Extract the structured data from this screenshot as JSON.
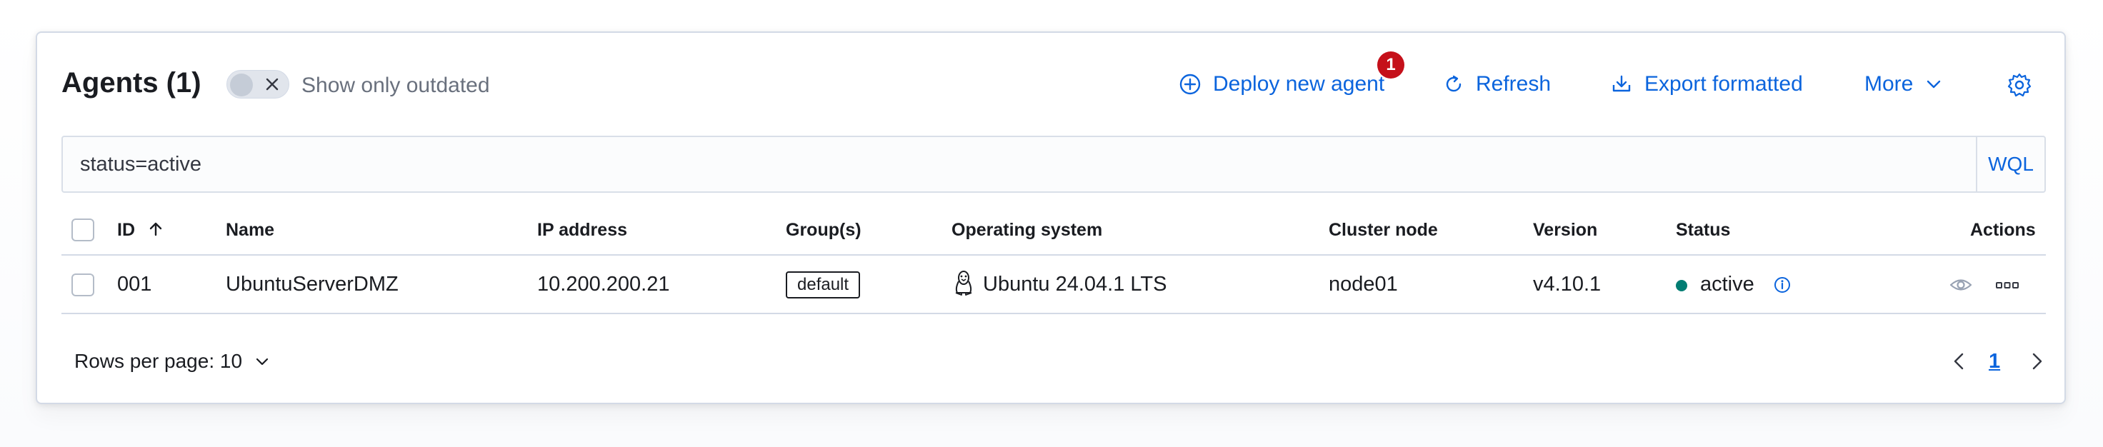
{
  "header": {
    "title": "Agents (1)",
    "toggle_label": "Show only outdated",
    "deploy_label": "Deploy new agent",
    "deploy_badge": "1",
    "refresh_label": "Refresh",
    "export_label": "Export formatted",
    "more_label": "More"
  },
  "search": {
    "value": "status=active",
    "language_button": "WQL"
  },
  "table": {
    "columns": [
      "ID",
      "Name",
      "IP address",
      "Group(s)",
      "Operating system",
      "Cluster node",
      "Version",
      "Status",
      "Actions"
    ],
    "rows": [
      {
        "id": "001",
        "name": "UbuntuServerDMZ",
        "ip": "10.200.200.21",
        "group": "default",
        "os": "Ubuntu 24.04.1 LTS",
        "cluster_node": "node01",
        "version": "v4.10.1",
        "status": "active"
      }
    ]
  },
  "footer": {
    "rows_per_page": "Rows per page: 10",
    "current_page": "1"
  },
  "colors": {
    "accent": "#0b64dd",
    "badge": "#c5101a",
    "status_active": "#017d73",
    "border": "#d3dae6"
  },
  "icons": {
    "deploy": "plus-circle-icon",
    "refresh": "refresh-icon",
    "export": "download-icon",
    "more": "chevron-down-icon",
    "settings": "gear-icon",
    "sort": "arrow-up-icon",
    "os": "linux-icon",
    "status_info": "info-icon",
    "view": "eye-icon",
    "actions": "ellipsis-icon"
  }
}
